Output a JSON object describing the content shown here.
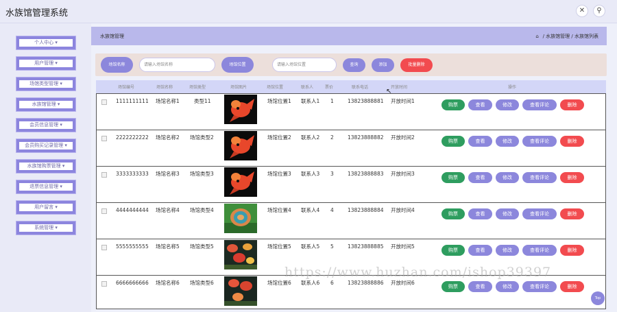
{
  "app": {
    "title": "水族馆管理系统",
    "fullscreen_icon": "✕",
    "user_icon": "⚲"
  },
  "sidebar": {
    "items": [
      {
        "label": "个人中心 ▾"
      },
      {
        "label": "用户管理 ▾"
      },
      {
        "label": "场馆类型管理 ▾"
      },
      {
        "label": "水族馆管理 ▾"
      },
      {
        "label": "会员信息管理 ▾"
      },
      {
        "label": "会员购买记录管理 ▾"
      },
      {
        "label": "水族馆购票管理 ▾"
      },
      {
        "label": "退票信息管理 ▾"
      },
      {
        "label": "用户留言 ▾"
      },
      {
        "label": "系统管理 ▾"
      }
    ]
  },
  "header": {
    "title": "水族馆管理",
    "breadcrumb": "/ 水族馆管理 / 水族馆列表"
  },
  "search": {
    "name_label": "场馆名称",
    "name_placeholder": "请输入场馆名称",
    "location_label": "场馆位置",
    "location_placeholder": "请输入场馆位置",
    "query_button": "查询",
    "add_button": "添加",
    "batch_delete_button": "批量删除"
  },
  "table": {
    "columns": [
      "场馆编号",
      "场馆名称",
      "场馆类型",
      "场馆图片",
      "场馆位置",
      "联系人",
      "票价",
      "联系电话",
      "开放时间",
      "操作"
    ],
    "rows": [
      {
        "id": "1111111111",
        "name": "场馆名称1",
        "type": "类型11",
        "location": "场馆位置1",
        "contact": "联系人1",
        "price": "1",
        "phone": "13823888881",
        "open": "开放时间1"
      },
      {
        "id": "2222222222",
        "name": "场馆名称2",
        "type": "场馆类型2",
        "location": "场馆位置2",
        "contact": "联系人2",
        "price": "2",
        "phone": "13823888882",
        "open": "开放时间2"
      },
      {
        "id": "3333333333",
        "name": "场馆名称3",
        "type": "场馆类型3",
        "location": "场馆位置3",
        "contact": "联系人3",
        "price": "3",
        "phone": "13823888883",
        "open": "开放时间3"
      },
      {
        "id": "4444444444",
        "name": "场馆名称4",
        "type": "场馆类型4",
        "location": "场馆位置4",
        "contact": "联系人4",
        "price": "4",
        "phone": "13823888884",
        "open": "开放时间4"
      },
      {
        "id": "5555555555",
        "name": "场馆名称5",
        "type": "场馆类型5",
        "location": "场馆位置5",
        "contact": "联系人5",
        "price": "5",
        "phone": "13823888885",
        "open": "开放时间5"
      },
      {
        "id": "6666666666",
        "name": "场馆名称6",
        "type": "场馆类型6",
        "location": "场馆位置6",
        "contact": "联系人6",
        "price": "6",
        "phone": "13823888886",
        "open": "开放时间6"
      }
    ],
    "actions": {
      "buy": "购票",
      "view": "查看",
      "edit": "修改",
      "review": "查看评论",
      "delete": "删除"
    }
  },
  "watermark": "https://www.huzhan.com/ishop39397",
  "fab": "Top",
  "colors": {
    "accent": "#8c87dc",
    "danger": "#f24b4f",
    "success": "#2e9d5f",
    "header": "#b9b8eb"
  }
}
